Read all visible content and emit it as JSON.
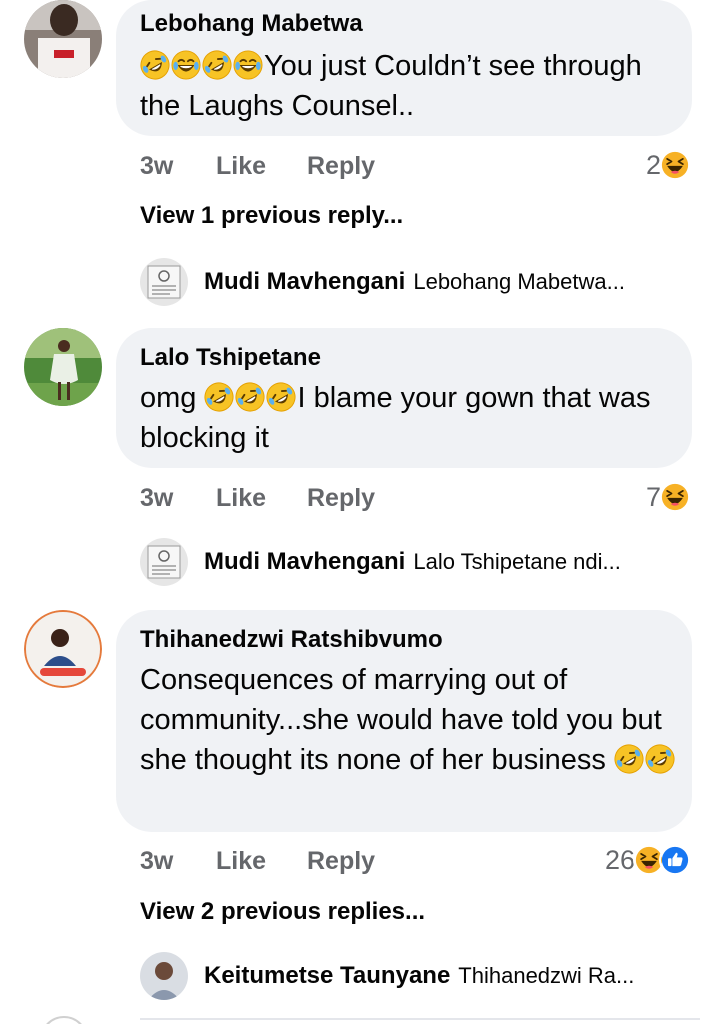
{
  "comments": [
    {
      "author": "Lebohang Mabetwa",
      "text": "You just Couldn’t see through the Laughs Counsel..",
      "time": "3w",
      "like_label": "Like",
      "reply_label": "Reply",
      "reaction_count": "2",
      "reaction_icons": [
        "haha-reaction-icon"
      ],
      "view_previous": "View 1 previous reply...",
      "reply_preview": {
        "author": "Mudi Mavhengani",
        "snippet": "Lebohang Mabetwa..."
      }
    },
    {
      "author": "Lalo Tshipetane",
      "text_prefix": "omg",
      "text": "I blame your gown that was blocking it",
      "time": "3w",
      "like_label": "Like",
      "reply_label": "Reply",
      "reaction_count": "7",
      "reaction_icons": [
        "haha-reaction-icon"
      ],
      "reply_preview": {
        "author": "Mudi Mavhengani",
        "snippet": "Lalo Tshipetane ndi..."
      }
    },
    {
      "author": "Thihanedzwi Ratshibvumo",
      "text": "Consequences of marrying out of community...she would have told you but she thought its none of her business",
      "time": "3w",
      "like_label": "Like",
      "reply_label": "Reply",
      "reaction_count": "26",
      "reaction_icons": [
        "haha-reaction-icon",
        "like-reaction-icon"
      ],
      "view_previous": "View 2 previous replies...",
      "reply_preview": {
        "author": "Keitumetse Taunyane",
        "snippet": "Thihanedzwi Ra..."
      }
    }
  ],
  "colors": {
    "bubble_bg": "#f0f2f5",
    "meta_text": "#65676b",
    "primary_text": "#050505",
    "haha_yellow": "#f7b125",
    "like_blue": "#1877f2"
  }
}
